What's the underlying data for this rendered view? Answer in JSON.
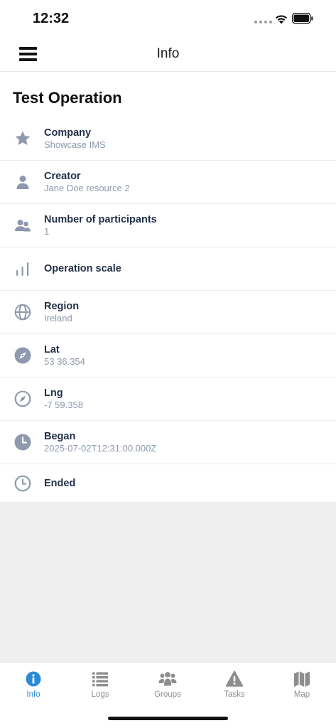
{
  "status_bar": {
    "time": "12:32"
  },
  "header": {
    "title": "Info"
  },
  "operation": {
    "title": "Test Operation",
    "rows": [
      {
        "label": "Company",
        "value": "Showcase IMS",
        "icon": "star-icon"
      },
      {
        "label": "Creator",
        "value": "Jane Doe resource 2",
        "icon": "person-icon"
      },
      {
        "label": "Number of participants",
        "value": "1",
        "icon": "people-icon"
      },
      {
        "label": "Operation scale",
        "value": "",
        "icon": "bars-icon"
      },
      {
        "label": "Region",
        "value": "Ireland",
        "icon": "globe-icon"
      },
      {
        "label": "Lat",
        "value": "53 36.354",
        "icon": "compass-filled-icon"
      },
      {
        "label": "Lng",
        "value": "-7 59.358",
        "icon": "compass-outline-icon"
      },
      {
        "label": "Began",
        "value": "2025-07-02T12:31:00.000Z",
        "icon": "clock-filled-icon"
      },
      {
        "label": "Ended",
        "value": "",
        "icon": "clock-outline-icon"
      }
    ]
  },
  "tab_bar": {
    "tabs": [
      {
        "label": "Info",
        "icon": "info-icon",
        "active": true
      },
      {
        "label": "Logs",
        "icon": "list-icon",
        "active": false
      },
      {
        "label": "Groups",
        "icon": "users-icon",
        "active": false
      },
      {
        "label": "Tasks",
        "icon": "warning-icon",
        "active": false
      },
      {
        "label": "Map",
        "icon": "map-icon",
        "active": false
      }
    ],
    "active_color": "#2b8ad6",
    "inactive_color": "#8e8e8e"
  },
  "colors": {
    "icon_gray": "#8e99ad",
    "label": "#223048",
    "value": "#8e99ad"
  }
}
